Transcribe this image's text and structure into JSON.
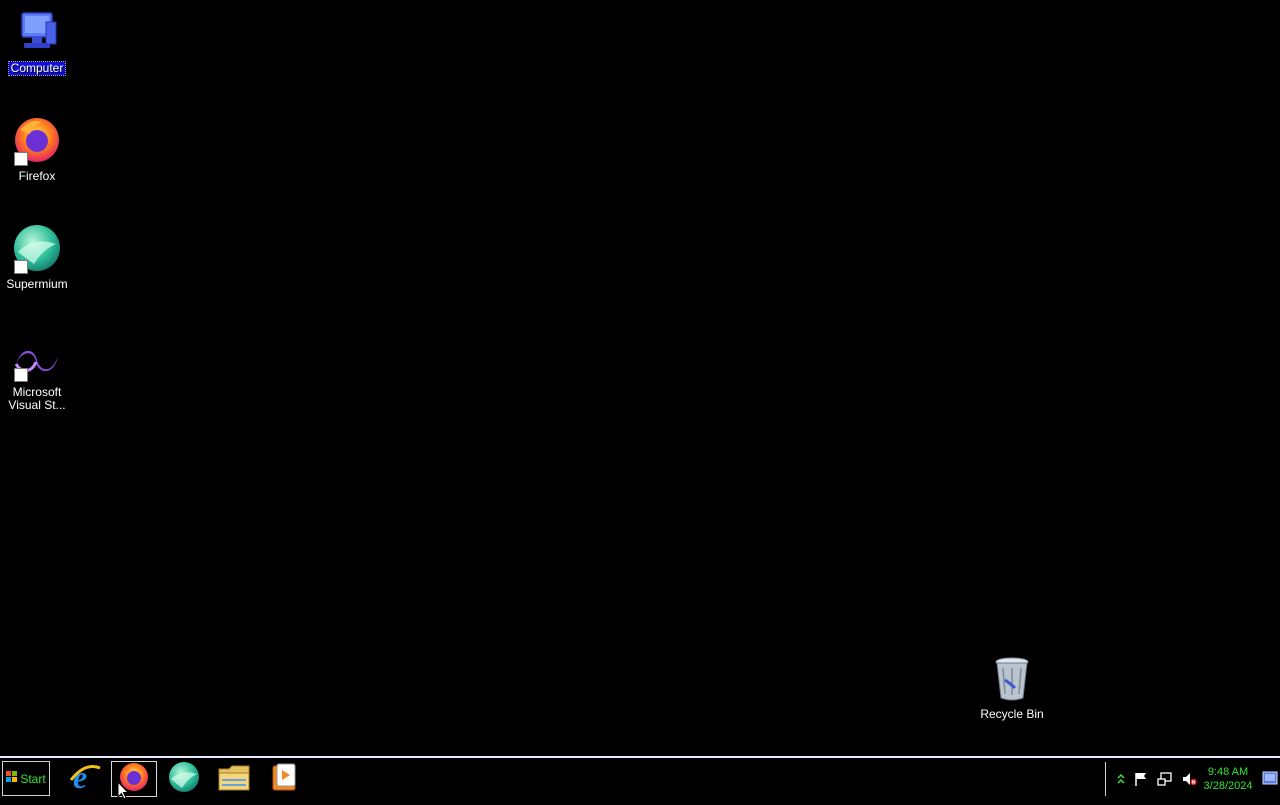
{
  "desktop": {
    "icons": [
      {
        "label": "Computer",
        "icon": "computer-icon",
        "selected": true
      },
      {
        "label": "Firefox",
        "icon": "firefox-icon"
      },
      {
        "label": "Supermium",
        "icon": "supermium-icon"
      },
      {
        "label": "Microsoft Visual St...",
        "label_line1": "Microsoft",
        "label_line2": "Visual St...",
        "icon": "visual-studio-icon"
      },
      {
        "label": "Recycle Bin",
        "icon": "recycle-bin-icon"
      }
    ]
  },
  "taskbar": {
    "start_label": "Start",
    "buttons": [
      {
        "icon": "internet-explorer-icon",
        "active": false
      },
      {
        "icon": "firefox-icon",
        "active": true
      },
      {
        "icon": "supermium-icon",
        "active": false
      },
      {
        "icon": "file-explorer-icon",
        "active": false
      },
      {
        "icon": "media-player-icon",
        "active": false
      }
    ],
    "tray": {
      "icons": [
        "show-hidden-icons-chevron-icon",
        "action-center-flag-icon",
        "network-icon",
        "volume-muted-icon"
      ],
      "time": "9:48 AM",
      "date": "3/28/2024"
    }
  },
  "colors": {
    "background": "#000000",
    "selection": "#1010d8",
    "accent_text": "#35e235"
  }
}
